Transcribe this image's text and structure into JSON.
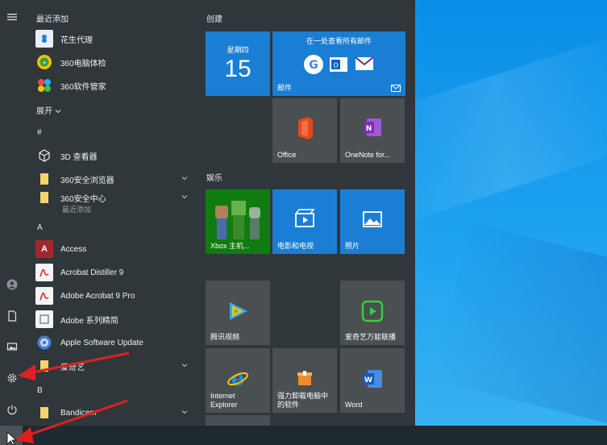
{
  "applist": {
    "recent_title": "最近添加",
    "recent": [
      {
        "label": "花生代理"
      },
      {
        "label": "360电脑体检"
      },
      {
        "label": "360软件管家"
      }
    ],
    "expand_label": "展开",
    "hash_letter": "#",
    "hash_apps": [
      {
        "label": "3D 查看器"
      },
      {
        "label": "360安全浏览器"
      },
      {
        "label": "360安全中心",
        "sub": "最近添加"
      }
    ],
    "a_letter": "A",
    "a_apps": [
      {
        "label": "Access"
      },
      {
        "label": "Acrobat Distiller 9"
      },
      {
        "label": "Adobe Acrobat 9 Pro"
      },
      {
        "label": "Adobe 系列精简"
      },
      {
        "label": "Apple Software Update"
      },
      {
        "label": "爱奇艺"
      }
    ],
    "b_letter": "B",
    "b_apps": [
      {
        "label": "Bandicam"
      }
    ]
  },
  "groups": {
    "create": "创建",
    "entertainment": "娱乐"
  },
  "tiles": {
    "calendar": {
      "weekday": "星期四",
      "day": "15"
    },
    "mail": {
      "top": "在一处查看所有邮件",
      "label": "邮件"
    },
    "office": {
      "label": "Office"
    },
    "onenote": {
      "label": "OneNote for..."
    },
    "xbox": {
      "label": "Xbox 主机..."
    },
    "movies": {
      "label": "电影和电视"
    },
    "photos": {
      "label": "照片"
    },
    "tencent": {
      "label": "腾讯视频"
    },
    "iqiyi": {
      "label": "爱奇艺万能联播"
    },
    "ie": {
      "label1": "Internet",
      "label2": "Explorer"
    },
    "uninstall": {
      "label1": "强力卸载电脑中",
      "label2": "的软件"
    },
    "word": {
      "label": "Word"
    }
  },
  "colors": {
    "tile_blue": "#1a7fd4",
    "tile_dark": "#4a4f52",
    "tile_green": "#107c10",
    "annotation_red": "#e02020"
  }
}
